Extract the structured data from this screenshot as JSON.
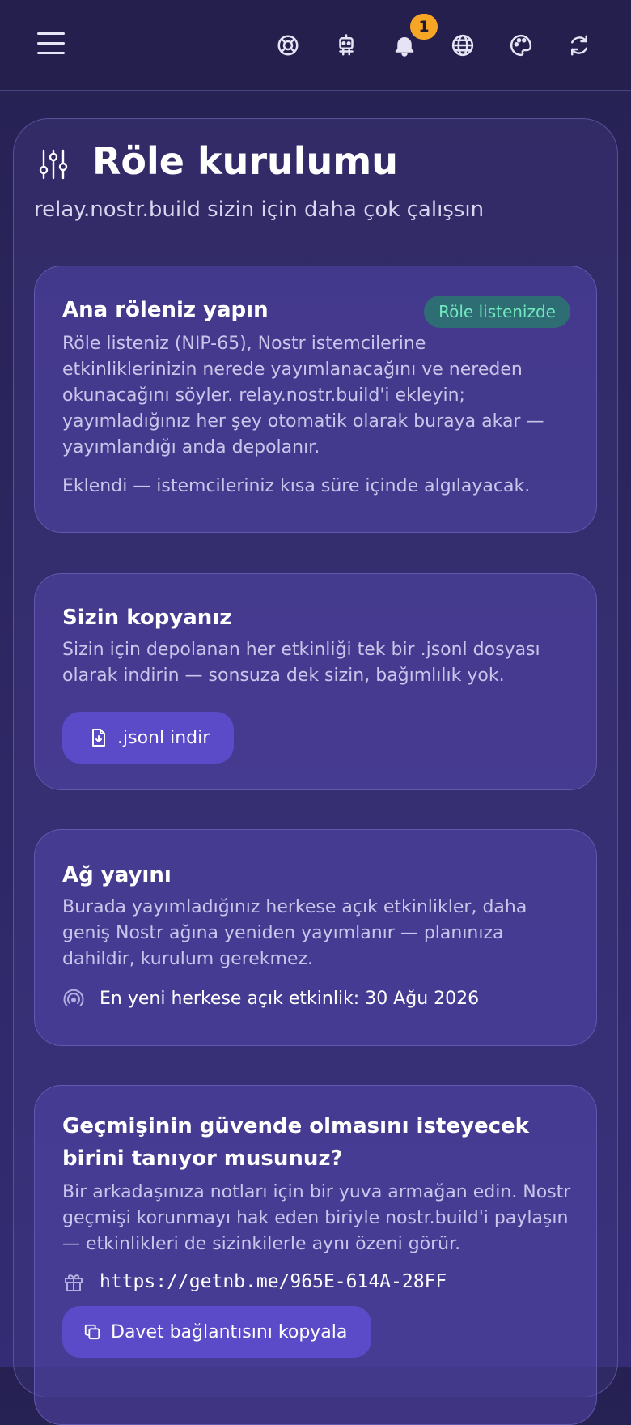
{
  "header": {
    "notification_count": "1",
    "icons": [
      "menu-icon",
      "lifebuoy-icon",
      "robot-icon",
      "bell-icon",
      "globe-icon",
      "palette-icon",
      "refresh-icon"
    ]
  },
  "page": {
    "title": "Röle kurulumu",
    "subtitle": "relay.nostr.build sizin için daha çok çalışsın"
  },
  "home_relay": {
    "title": "Ana röleniz yapın",
    "status_badge": "Röle listenizde",
    "description": "Röle listeniz (NIP-65), Nostr istemcilerine etkinliklerinizin nerede yayımlanacağını ve nereden okunacağını söyler. relay.nostr.build'i ekleyin; yayımladığınız her şey otomatik olarak buraya akar — yayımlandığı anda depolanır.",
    "note": "Eklendi — istemcileriniz kısa süre içinde algılayacak."
  },
  "your_copy": {
    "title": "Sizin kopyanız",
    "description": "Sizin için depolanan her etkinliği tek bir .jsonl dosyası olarak indirin — sonsuza dek sizin, bağımlılık yok.",
    "button_label": ".jsonl indir"
  },
  "broadcast": {
    "title": "Ağ yayını",
    "description": "Burada yayımladığınız herkese açık etkinlikler, daha geniş Nostr ağına yeniden yayımlanır — planınıza dahildir, kurulum gerekmez.",
    "latest_event": "En yeni herkese açık etkinlik: 30 Ağu 2026"
  },
  "invite": {
    "title": "Geçmişinin güvende olmasını isteyecek birini tanıyor musunuz?",
    "description": "Bir arkadaşınıza notları için bir yuva armağan edin. Nostr geçmişi korunmayı hak eden biriyle nostr.build'i paylaşın — etkinlikleri de sizinkilerle aynı özeni görür.",
    "link": "https://getnb.me/965E-614A-28FF",
    "button_label": "Davet bağlantısını kopyala"
  },
  "colors": {
    "background": "#2a2459",
    "card": "#4a3f9c",
    "accent_button": "#5b4bc8",
    "badge_green": "#71e9bf",
    "notification": "#f7a524"
  }
}
